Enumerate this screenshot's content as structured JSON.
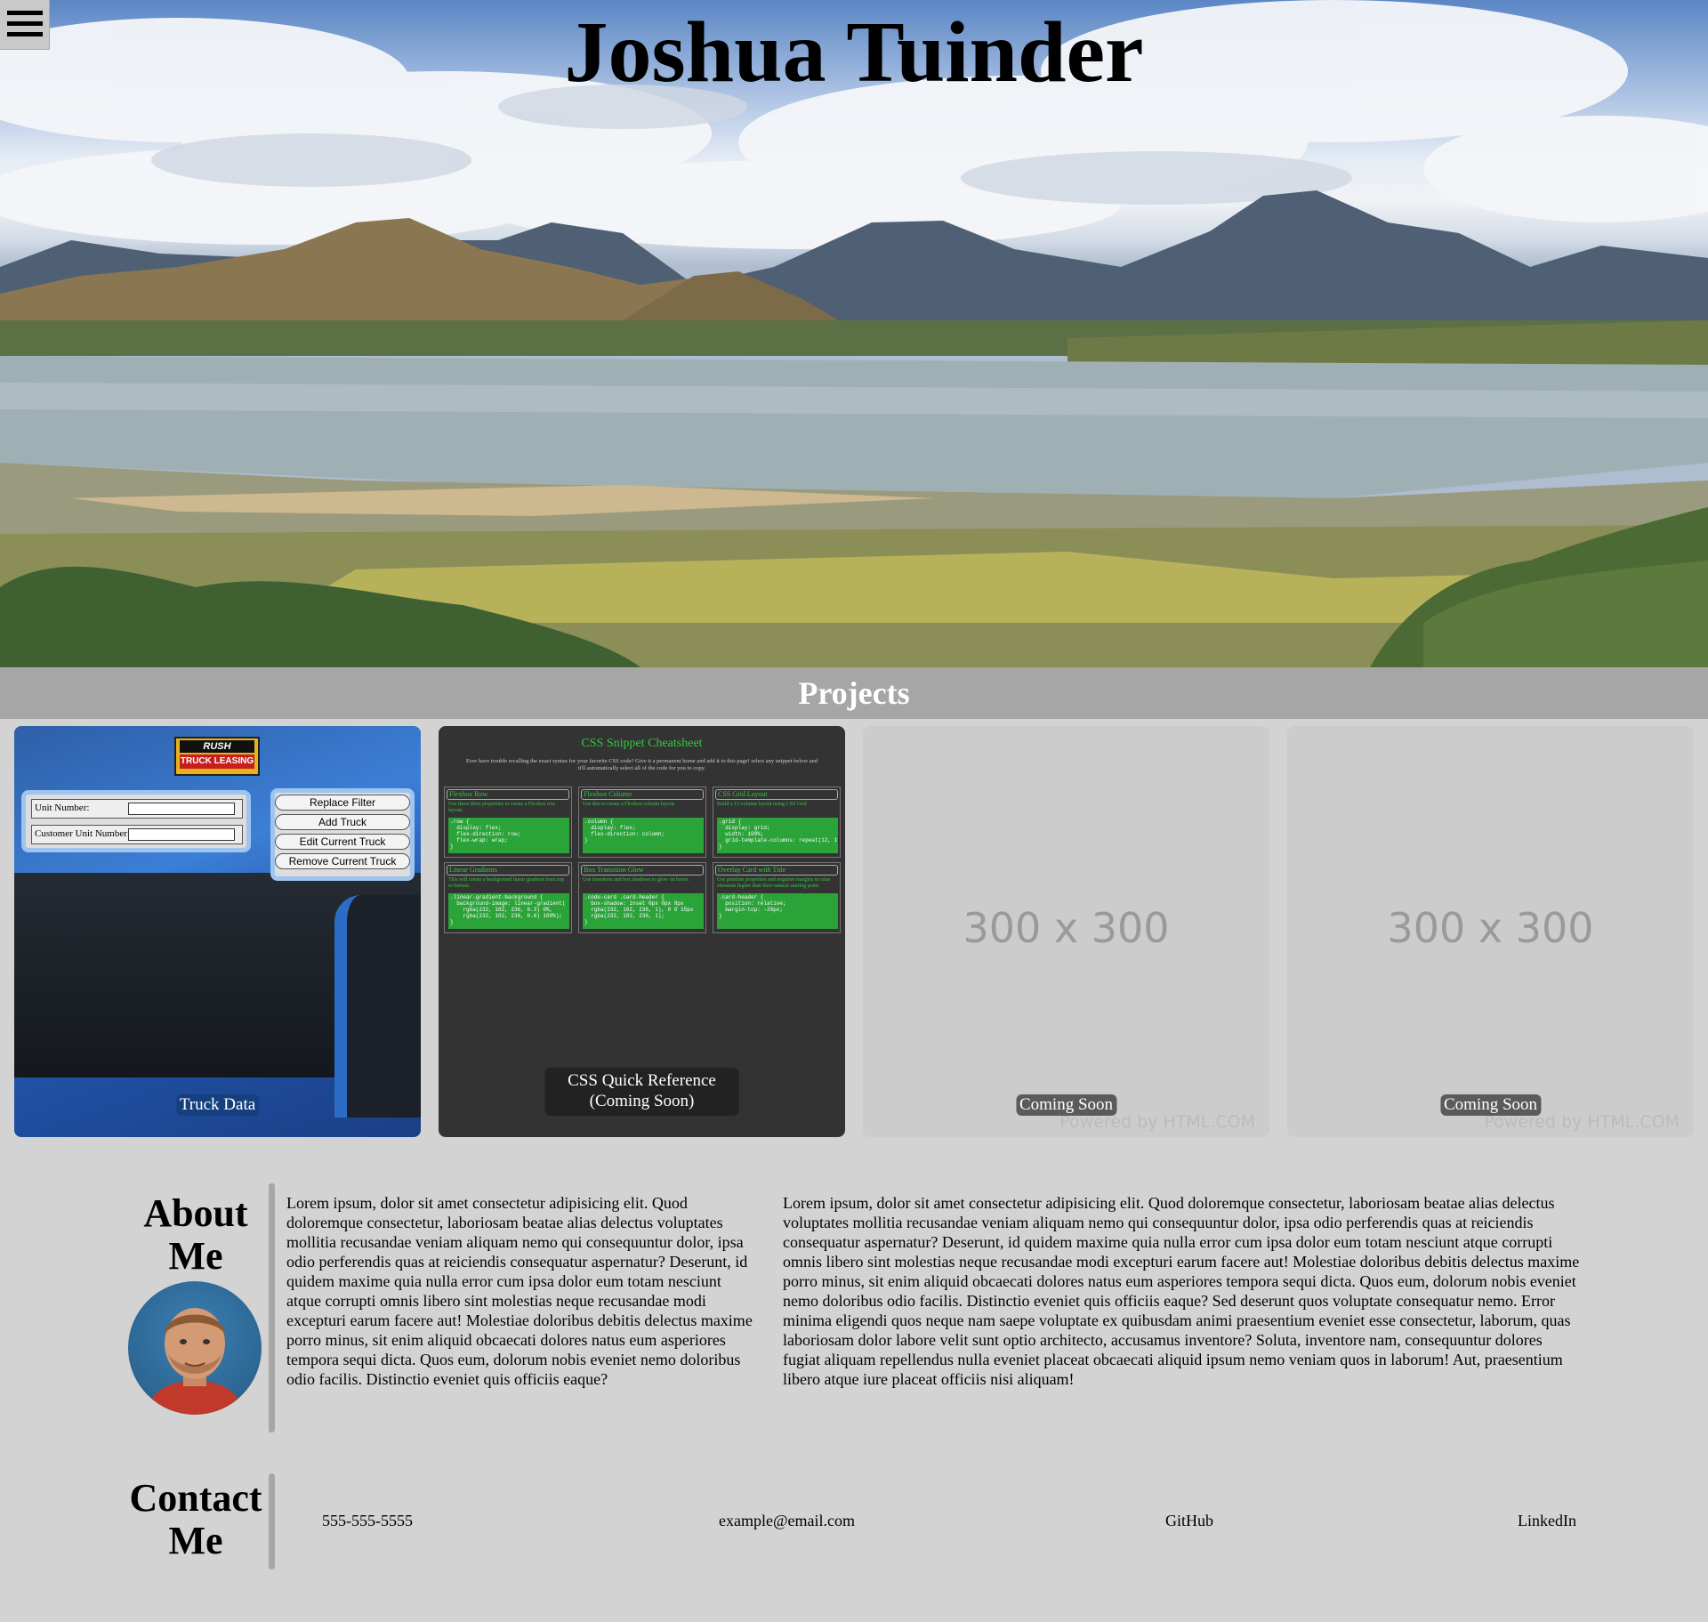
{
  "hero": {
    "title": "Joshua Tuinder"
  },
  "menu": {
    "icon": "hamburger-menu-icon"
  },
  "projects": {
    "heading": "Projects",
    "cards": [
      {
        "label": "Truck Data",
        "logo": {
          "line1": "RUSH",
          "line2": "TRUCK LEASING"
        },
        "form": {
          "unit_label": "Unit Number:",
          "customer_label": "Customer Unit Number:"
        },
        "buttons": [
          "Replace Filter",
          "Add Truck",
          "Edit Current Truck",
          "Remove Current Truck"
        ]
      },
      {
        "label_line1": "CSS Quick Reference",
        "label_line2": "(Coming Soon)",
        "preview_title": "CSS Snippet Cheatsheet",
        "preview_sub": "Ever have trouble recalling the exact syntax for your favorite CSS code? Give it a permanent home and add it to this page! select any snippet below and it'll automatically select all of the code for you to copy.",
        "snippets": [
          {
            "title": "Flexbox Row",
            "desc": "Use these three properties to create a Flexbox row layout.",
            "code": ".row {\n  display: flex;\n  flex-direction: row;\n  flex-wrap: wrap;\n}"
          },
          {
            "title": "Flexbox Column",
            "desc": "Use this to create a Flexbox column layout.",
            "code": ".column {\n  display: flex;\n  flex-direction: column;\n}"
          },
          {
            "title": "CSS Grid Layout",
            "desc": "Build a 12-column layout using CSS Grid",
            "code": ".grid {\n  display: grid;\n  width: 100%;\n  grid-template-columns: repeat(12, 1fr);\n}"
          },
          {
            "title": "Linear Gradients",
            "desc": "This will create a background linear gradient from top to bottom.",
            "code": ".linear-gradient-background {\n  background-image: linear-gradient(\n    rgba(232, 102, 236, 0.3) 0%,\n    rgba(232, 102, 236, 0.6) 100%);\n}"
          },
          {
            "title": "Box Transition Glow",
            "desc": "Use transition and box shadows to glow on hover.",
            "code": ".code-card .card-header {\n  box-shadow: inset 0px 0px 8px\n  rgba(232, 102, 236, 1), 0 0 15px\n  rgba(232, 102, 236, 1);\n}"
          },
          {
            "title": "Overlay Card with Title",
            "desc": "Use position properties and negative margins to raise elements higher than their natural starting point.",
            "code": ".card-header {\n  position: relative;\n  margin-top: -20px;\n}"
          }
        ]
      },
      {
        "label": "Coming Soon",
        "placeholder": "300 x 300",
        "powered": "Powered by HTML.COM"
      },
      {
        "label": "Coming Soon",
        "placeholder": "300 x 300",
        "powered": "Powered by HTML.COM"
      }
    ]
  },
  "about": {
    "heading_line1": "About",
    "heading_line2": "Me",
    "para1": "Lorem ipsum, dolor sit amet consectetur adipisicing elit. Quod doloremque consectetur, laboriosam beatae alias delectus voluptates mollitia recusandae veniam aliquam nemo qui consequuntur dolor, ipsa odio perferendis quas at reiciendis consequatur aspernatur? Deserunt, id quidem maxime quia nulla error cum ipsa dolor eum totam nesciunt atque corrupti omnis libero sint molestias neque recusandae modi excepturi earum facere aut! Molestiae doloribus debitis delectus maxime porro minus, sit enim aliquid obcaecati dolores natus eum asperiores tempora sequi dicta. Quos eum, dolorum nobis eveniet nemo doloribus odio facilis. Distinctio eveniet quis officiis eaque?",
    "para2": "Lorem ipsum, dolor sit amet consectetur adipisicing elit. Quod doloremque consectetur, laboriosam beatae alias delectus voluptates mollitia recusandae veniam aliquam nemo qui consequuntur dolor, ipsa odio perferendis quas at reiciendis consequatur aspernatur? Deserunt, id quidem maxime quia nulla error cum ipsa dolor eum totam nesciunt atque corrupti omnis libero sint molestias neque recusandae modi excepturi earum facere aut! Molestiae doloribus debitis delectus maxime porro minus, sit enim aliquid obcaecati dolores natus eum asperiores tempora sequi dicta. Quos eum, dolorum nobis eveniet nemo doloribus odio facilis. Distinctio eveniet quis officiis eaque? Sed deserunt quos voluptate consequatur nemo. Error minima eligendi quos neque nam saepe voluptate ex quibusdam animi praesentium eveniet esse consectetur, laborum, quas laboriosam dolor labore velit sunt optio architecto, accusamus inventore? Soluta, inventore nam, consequuntur dolores fugiat aliquam repellendus nulla eveniet placeat obcaecati aliquid ipsum nemo veniam quos in laborum! Aut, praesentium libero atque iure placeat officiis nisi aliquam!"
  },
  "contact": {
    "heading_line1": "Contact",
    "heading_line2": "Me",
    "phone": "555-555-5555",
    "email": "example@email.com",
    "github": "GitHub",
    "linkedin": "LinkedIn"
  },
  "colors": {
    "page_bg": "#d3d3d3",
    "band_bg": "#a6a6a6",
    "snippet_green": "#36c742",
    "dark_card": "#333333"
  }
}
